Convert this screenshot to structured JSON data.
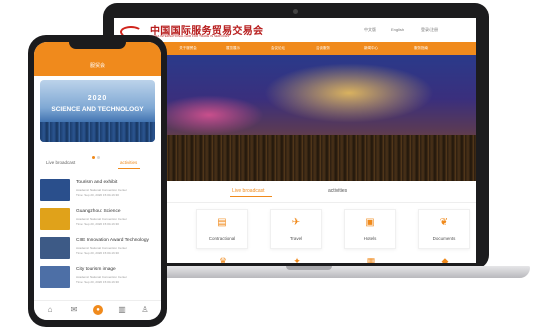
{
  "laptop": {
    "logo_text": "中国国际服务贸易交易会",
    "logo_subtitle": "CHINA INTERNATIONAL FAIR FOR TRADE IN SERVICES",
    "header_links": [
      "中文版",
      "English",
      "登录/注册"
    ],
    "nav_items": [
      "首页",
      "关于服贸会",
      "展览展示",
      "会议论坛",
      "洽谈服务",
      "新闻中心",
      "服务指南"
    ],
    "tabs": [
      "Live broadcast",
      "activities"
    ],
    "services_row1": [
      {
        "label": "Contractional",
        "icon": "document-icon"
      },
      {
        "label": "Travel",
        "icon": "travel-icon"
      },
      {
        "label": "Hotels",
        "icon": "hotel-icon"
      },
      {
        "label": "Documents",
        "icon": "leaf-icon"
      }
    ]
  },
  "phone": {
    "title": "服贸会",
    "banner": {
      "year": "2020",
      "text": "SCIENCE AND TECHNOLOGY"
    },
    "tabs": [
      "Live broadcast",
      "activities"
    ],
    "news": [
      {
        "title": "Tourism and exhibit",
        "line1": "Academic National Convention Center",
        "line2": "Time: Sep 20, 2020 15:00-16:30",
        "thumb_color": "#2a4f8c"
      },
      {
        "title": "Guangzhou: Science",
        "line1": "Academic National Convention Center",
        "line2": "Time: Sep 20, 2020 15:00-16:30",
        "thumb_color": "#e0a21a"
      },
      {
        "title": "CIIE Innovation Award Technology",
        "line1": "Academic National Convention Center",
        "line2": "Time: Sep 20, 2020 15:00-16:30",
        "thumb_color": "#3d5a86"
      },
      {
        "title": "City tourism image",
        "line1": "Academic National Convention Center",
        "line2": "Time: Sep 20, 2020 15:00-16:30",
        "thumb_color": "#4d6fa6"
      }
    ],
    "bottom_icons": [
      "home-icon",
      "message-icon",
      "live-icon",
      "building-icon",
      "user-icon"
    ]
  },
  "colors": {
    "accent": "#f08a1c",
    "brand_red": "#b71c1c"
  }
}
